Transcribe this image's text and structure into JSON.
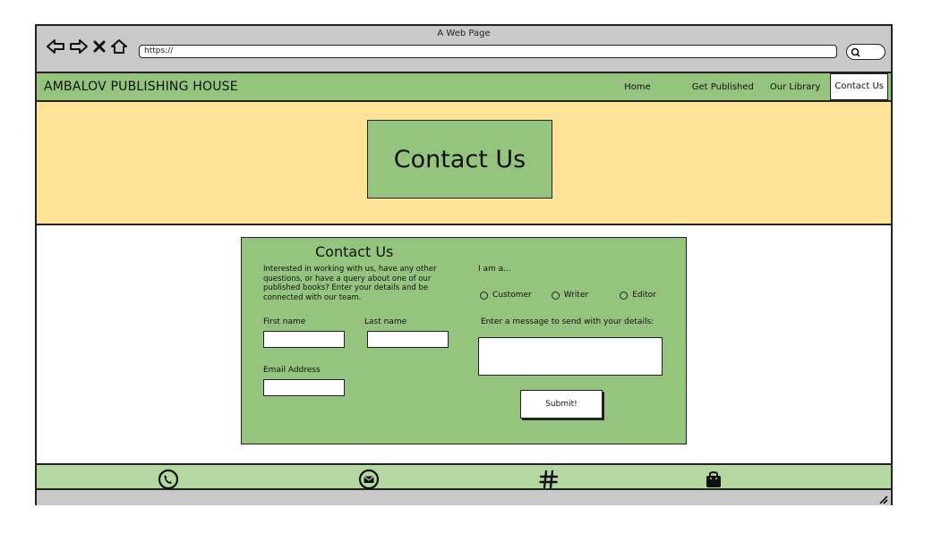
{
  "browser": {
    "window_title": "A Web Page",
    "url": "https://"
  },
  "header": {
    "brand": "AMBALOV PUBLISHING HOUSE",
    "menu": [
      {
        "label": "Home"
      },
      {
        "label": "Get Published"
      },
      {
        "label": "Our Library"
      },
      {
        "label": "Contact Us",
        "active": true
      }
    ]
  },
  "hero": {
    "title": "Contact Us"
  },
  "form": {
    "title": "Contact Us",
    "intro": "Interested in working with us, have any other questions, or have a query about one of our published books? Enter your details and be connected with our team.",
    "first_name_label": "First name",
    "first_name_value": "",
    "last_name_label": "Last name",
    "last_name_value": "",
    "email_label": "Email Address",
    "email_value": "",
    "role_label": "I am a...",
    "roles": [
      "Customer",
      "Writer",
      "Editor"
    ],
    "message_label": "Enter a message to send with your details:",
    "message_value": "",
    "submit_label": "Submit!"
  },
  "footer": {
    "icons": [
      "phone-icon",
      "email-icon",
      "hashtag-icon",
      "shopping-bag-icon"
    ]
  },
  "colors": {
    "nav_green": "#94c47d",
    "hero_yellow": "#ffe396",
    "footer_green": "#b5d8a3",
    "chrome_gray": "#c9c9c9"
  }
}
